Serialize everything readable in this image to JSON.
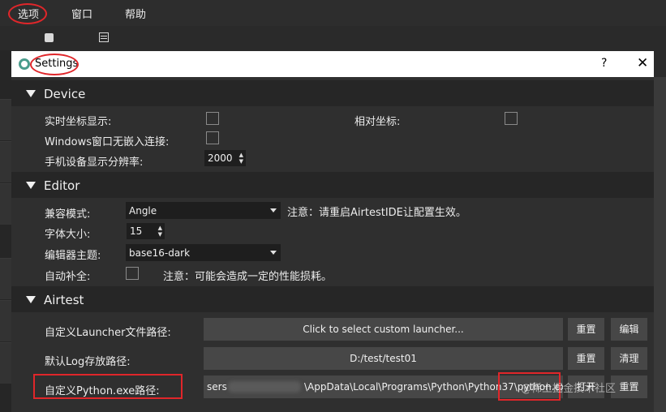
{
  "menu": {
    "options": "选项",
    "window": "窗口",
    "help": "帮助"
  },
  "dialog": {
    "title": "Settings",
    "help_button": "?",
    "close_button": "✕"
  },
  "device": {
    "header": "Device",
    "realtime_coords_label": "实时坐标显示:",
    "relative_coords_label": "相对坐标:",
    "windows_no_embed_label": "Windows窗口无嵌入连接:",
    "resolution_label": "手机设备显示分辨率:",
    "resolution_value": "2000"
  },
  "editor": {
    "header": "Editor",
    "compat_label": "兼容模式:",
    "compat_value": "Angle",
    "compat_note": "注意：请重启AirtestIDE让配置生效。",
    "font_size_label": "字体大小:",
    "font_size_value": "15",
    "theme_label": "编辑器主题:",
    "theme_value": "base16-dark",
    "autocomplete_label": "自动补全:",
    "autocomplete_note": "注意：可能会造成一定的性能损耗。"
  },
  "airtest": {
    "header": "Airtest",
    "launcher_label": "自定义Launcher文件路径:",
    "launcher_value": "Click to select custom launcher...",
    "launcher_reset": "重置",
    "launcher_edit": "编辑",
    "log_label": "默认Log存放路径:",
    "log_value": "D:/test/test01",
    "log_reset": "重置",
    "log_clear": "清理",
    "python_label": "自定义Python.exe路径:",
    "python_value_start": "sers",
    "python_value_end": "\\AppData\\Local\\Programs\\Python\\Python37\\python.exe",
    "python_open": "打开",
    "python_reset": "重置"
  },
  "watermark": "@稀土掘金技术社区",
  "colors": {
    "annotation_red": "#e0262a",
    "section_header_bg": "#262626",
    "dialog_bg": "#2f2f2f",
    "button_bg": "#474747"
  },
  "icons": {
    "settings_gear": "gear-icon",
    "toolbar_stop": "stop-icon",
    "toolbar_list": "list-icon"
  }
}
